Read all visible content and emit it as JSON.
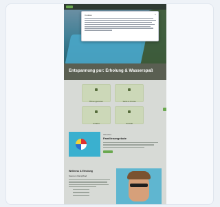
{
  "page": {
    "hero_title": "Entspannung pur: Erholung & Wasserspaß"
  },
  "cookie_banner": {
    "title": "Cookies",
    "close_glyph": "×"
  },
  "tiles": [
    {
      "label": "Öffnungszeiten",
      "icon": "clock-icon"
    },
    {
      "label": "Tarife & Preise",
      "icon": "ticket-icon"
    },
    {
      "label": "Anfahrt",
      "icon": "map-pin-icon"
    },
    {
      "label": "Kontakt",
      "icon": "phone-icon"
    }
  ],
  "promo": {
    "kicker": "Aktuelles",
    "title": "Familienangebote"
  },
  "bottom": {
    "title": "Wellness & Erholung",
    "subtitle": "Sauna & Dampfbad"
  },
  "colors": {
    "accent": "#6aa84f",
    "topbar": "#2f3b33",
    "tile_bg": "#ccd8b8"
  }
}
